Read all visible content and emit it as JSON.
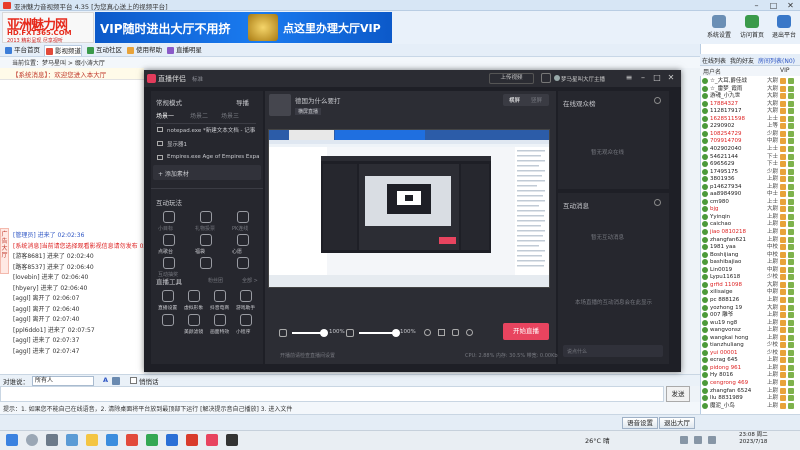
{
  "app": {
    "window_title": "亚洲魅力音视频平台 4.35 [为您真心送上的视频平台]",
    "logo_line1": "亚洲魅力网",
    "logo_line2": "HD.FXT365.COM",
    "logo_line3": "2013 精彩呈现 尽享视听",
    "vip_ad_left": "VIP随时进出大厅不用挤",
    "vip_ad_right": "点这里办理大厅VIP",
    "top_buttons": [
      {
        "label": "系统设置"
      },
      {
        "label": "访问首页"
      },
      {
        "label": "退出平台"
      }
    ]
  },
  "nav_tabs": [
    {
      "label": "平台首页",
      "color": "#3b7dd8"
    },
    {
      "label": "影视频道",
      "color": "#e24a3a"
    },
    {
      "label": "互动社区",
      "color": "#3a9a4a"
    },
    {
      "label": "使用帮助",
      "color": "#e8a33a"
    },
    {
      "label": "直播明星",
      "color": "#8a5ac8"
    }
  ],
  "room_info": {
    "current_location": "当前位置：梦马星叫 > 缀小涛大厅",
    "notice": "【重要提醒】：文明聊天，严禁违规、刷屏、发布不良... 房间"
  },
  "chat_bar": {
    "label": "【系统消息】：欢迎您进入本大厅"
  },
  "side_tab": {
    "label": "广告大厅"
  },
  "messages": [
    {
      "text": "[管理员] 进来了 02:02:36",
      "style": "blue"
    },
    {
      "text": "[系统消息]当前请您选择观看影视信息请勿发布 02:02:39",
      "style": "red"
    },
    {
      "text": "[游客8681] 进来了 02:02:40",
      "style": ""
    },
    {
      "text": "[路客8537] 进来了 02:06:40",
      "style": ""
    },
    {
      "text": "[lovebin] 进来了 02:06:40",
      "style": ""
    },
    {
      "text": "[hbyery] 进来了 02:06:40",
      "style": ""
    },
    {
      "text": "[aggl] 离开了 02:06:07",
      "style": ""
    },
    {
      "text": "[aggl] 离开了 02:06:40",
      "style": ""
    },
    {
      "text": "[aggl] 离开了 02:07:40",
      "style": ""
    },
    {
      "text": "[ppl6ddo1] 进来了 02:07:57",
      "style": ""
    },
    {
      "text": "[aggl] 进来了 02:07:37",
      "style": ""
    },
    {
      "text": "[aggl] 进来了 02:07:47",
      "style": ""
    }
  ],
  "chat_input": {
    "talk_to_label": "对谁说：",
    "target": "所有人",
    "font_label": "A",
    "private_label": "悄悄话",
    "send_label": "发送"
  },
  "tip_row": {
    "text": "提示：1. 如果您不能自己在线语音，2. 清除桌面将平台放到最顶部下运行 [解决提示音自己播放] 3. 进入文件"
  },
  "bottom_buttons": [
    {
      "label": "语音设置"
    },
    {
      "label": "退出大厅"
    }
  ],
  "right_panel": {
    "tabs": [
      "在线列表",
      "我的好友",
      "房间列表(N0)"
    ],
    "col_user": "用户名",
    "col_vip": "VIP",
    "users": [
      {
        "name": "☆_大耳,爵佳战",
        "level": "大尉",
        "hl": false
      },
      {
        "name": "☆_雷梦_霞雨",
        "level": "大尉",
        "hl": false
      },
      {
        "name": "游魂_小九世",
        "level": "大尉",
        "hl": false
      },
      {
        "name": "17884327",
        "level": "大尉",
        "hl": true
      },
      {
        "name": "112817917",
        "level": "大尉",
        "hl": false
      },
      {
        "name": "1628511598",
        "level": "上士",
        "hl": true
      },
      {
        "name": "2290902",
        "level": "上等",
        "hl": false
      },
      {
        "name": "108254729",
        "level": "少尉",
        "hl": true
      },
      {
        "name": "709914709",
        "level": "中尉",
        "hl": true
      },
      {
        "name": "402902040",
        "level": "上士",
        "hl": false
      },
      {
        "name": "54621144",
        "level": "下士",
        "hl": false
      },
      {
        "name": "6965629",
        "level": "下士",
        "hl": false
      },
      {
        "name": "17495175",
        "level": "少尉",
        "hl": false
      },
      {
        "name": "3801936",
        "level": "上尉",
        "hl": false
      },
      {
        "name": "p14627934",
        "level": "上尉",
        "hl": false
      },
      {
        "name": "aa8984990",
        "level": "中士",
        "hl": false
      },
      {
        "name": "cm980",
        "level": "上士",
        "hl": false
      },
      {
        "name": "bjg",
        "level": "大尉",
        "hl": true
      },
      {
        "name": "Yyinqin",
        "level": "上尉",
        "hl": false
      },
      {
        "name": "caichao",
        "level": "上尉",
        "hl": false
      },
      {
        "name": "jiao 0810218",
        "level": "上尉",
        "hl": true
      },
      {
        "name": "zhangfan621",
        "level": "上尉",
        "hl": false
      },
      {
        "name": "1981 yaa",
        "level": "中校",
        "hl": false
      },
      {
        "name": "Boshijiang",
        "level": "中校",
        "hl": false
      },
      {
        "name": "bashibajiao",
        "level": "上尉",
        "hl": false
      },
      {
        "name": "Lin0019",
        "level": "中尉",
        "hl": false
      },
      {
        "name": "Lypu11618",
        "level": "少校",
        "hl": false
      },
      {
        "name": "grfid 11098",
        "level": "大尉",
        "hl": true
      },
      {
        "name": "xilisaige",
        "level": "中尉",
        "hl": false
      },
      {
        "name": "pc 888126",
        "level": "上尉",
        "hl": false
      },
      {
        "name": "yozhong 19",
        "level": "大尉",
        "hl": false
      },
      {
        "name": "007 雕爷",
        "level": "上尉",
        "hl": false
      },
      {
        "name": "wu19 ng8",
        "level": "上尉",
        "hl": false
      },
      {
        "name": "wangvonsz",
        "level": "上尉",
        "hl": false
      },
      {
        "name": "wangkai hong",
        "level": "上尉",
        "hl": false
      },
      {
        "name": "tianzhuliang",
        "level": "少校",
        "hl": false
      },
      {
        "name": "yui 00001",
        "level": "少校",
        "hl": true
      },
      {
        "name": "ecrag 645",
        "level": "上尉",
        "hl": false
      },
      {
        "name": "pidong 961",
        "level": "上尉",
        "hl": true
      },
      {
        "name": "Hy 8016",
        "level": "上尉",
        "hl": false
      },
      {
        "name": "cengrong 469",
        "level": "上尉",
        "hl": true
      },
      {
        "name": "zhangfan 6524",
        "level": "上尉",
        "hl": false
      },
      {
        "name": "llu 8831989",
        "level": "上尉",
        "hl": false
      },
      {
        "name": "魔泥_小鸟",
        "level": "上尉",
        "hl": false
      }
    ]
  },
  "obs": {
    "title": "直播伴侣",
    "subtitle": "标准",
    "upload_label": "上传视频",
    "user_label": "梦马星叫大厅主播",
    "scene_header": "常规模式",
    "scene_toggle": "导播",
    "scene_tabs": [
      "场景一",
      "场景二",
      "场景三"
    ],
    "sources": [
      "notepad.exe *新建文本文档 - 记事本",
      "显示器1",
      "Empires.exe Age of Empires Expan..."
    ],
    "add_source_label": "+ 添加素材",
    "interact_title": "互动玩法",
    "interact_items": [
      "小目标",
      "礼物投票",
      "PK连线",
      "点歌台",
      "福袋",
      "心愿",
      "互动抽奖",
      "",
      ""
    ],
    "tools_title": "直播工具",
    "tools_hint": "粉丝团",
    "tools_all": "全部 >",
    "tools_items": [
      "直播设置",
      "虚拟形象",
      "抖音电商",
      "游戏助手",
      "",
      "美颜滤镜",
      "画面特效",
      "小程序"
    ],
    "stream_title": "德国为什么要打",
    "stream_tag": "横屏直播",
    "mode_a": "横屏",
    "mode_b": "竖屏",
    "volume_mic": "100%",
    "volume_sys": "100%",
    "start_live_label": "开始直播",
    "bottom_left": "开播前请检查直播间设置",
    "stats": "CPU: 2.88%  内存: 30.5%  带宽: 0.00Kbps",
    "audience_title": "在线观众榜",
    "audience_empty": "暂无观众在线",
    "chat_title": "互动消息",
    "chat_empty": "暂无互动消息",
    "chat_hint": "本场直播的互动消息会在此显示",
    "chat_input_placeholder": "说点什么"
  },
  "taskbar": {
    "temperature": "26°C 晴",
    "time": "23:08 周二",
    "date": "2023/7/18"
  }
}
